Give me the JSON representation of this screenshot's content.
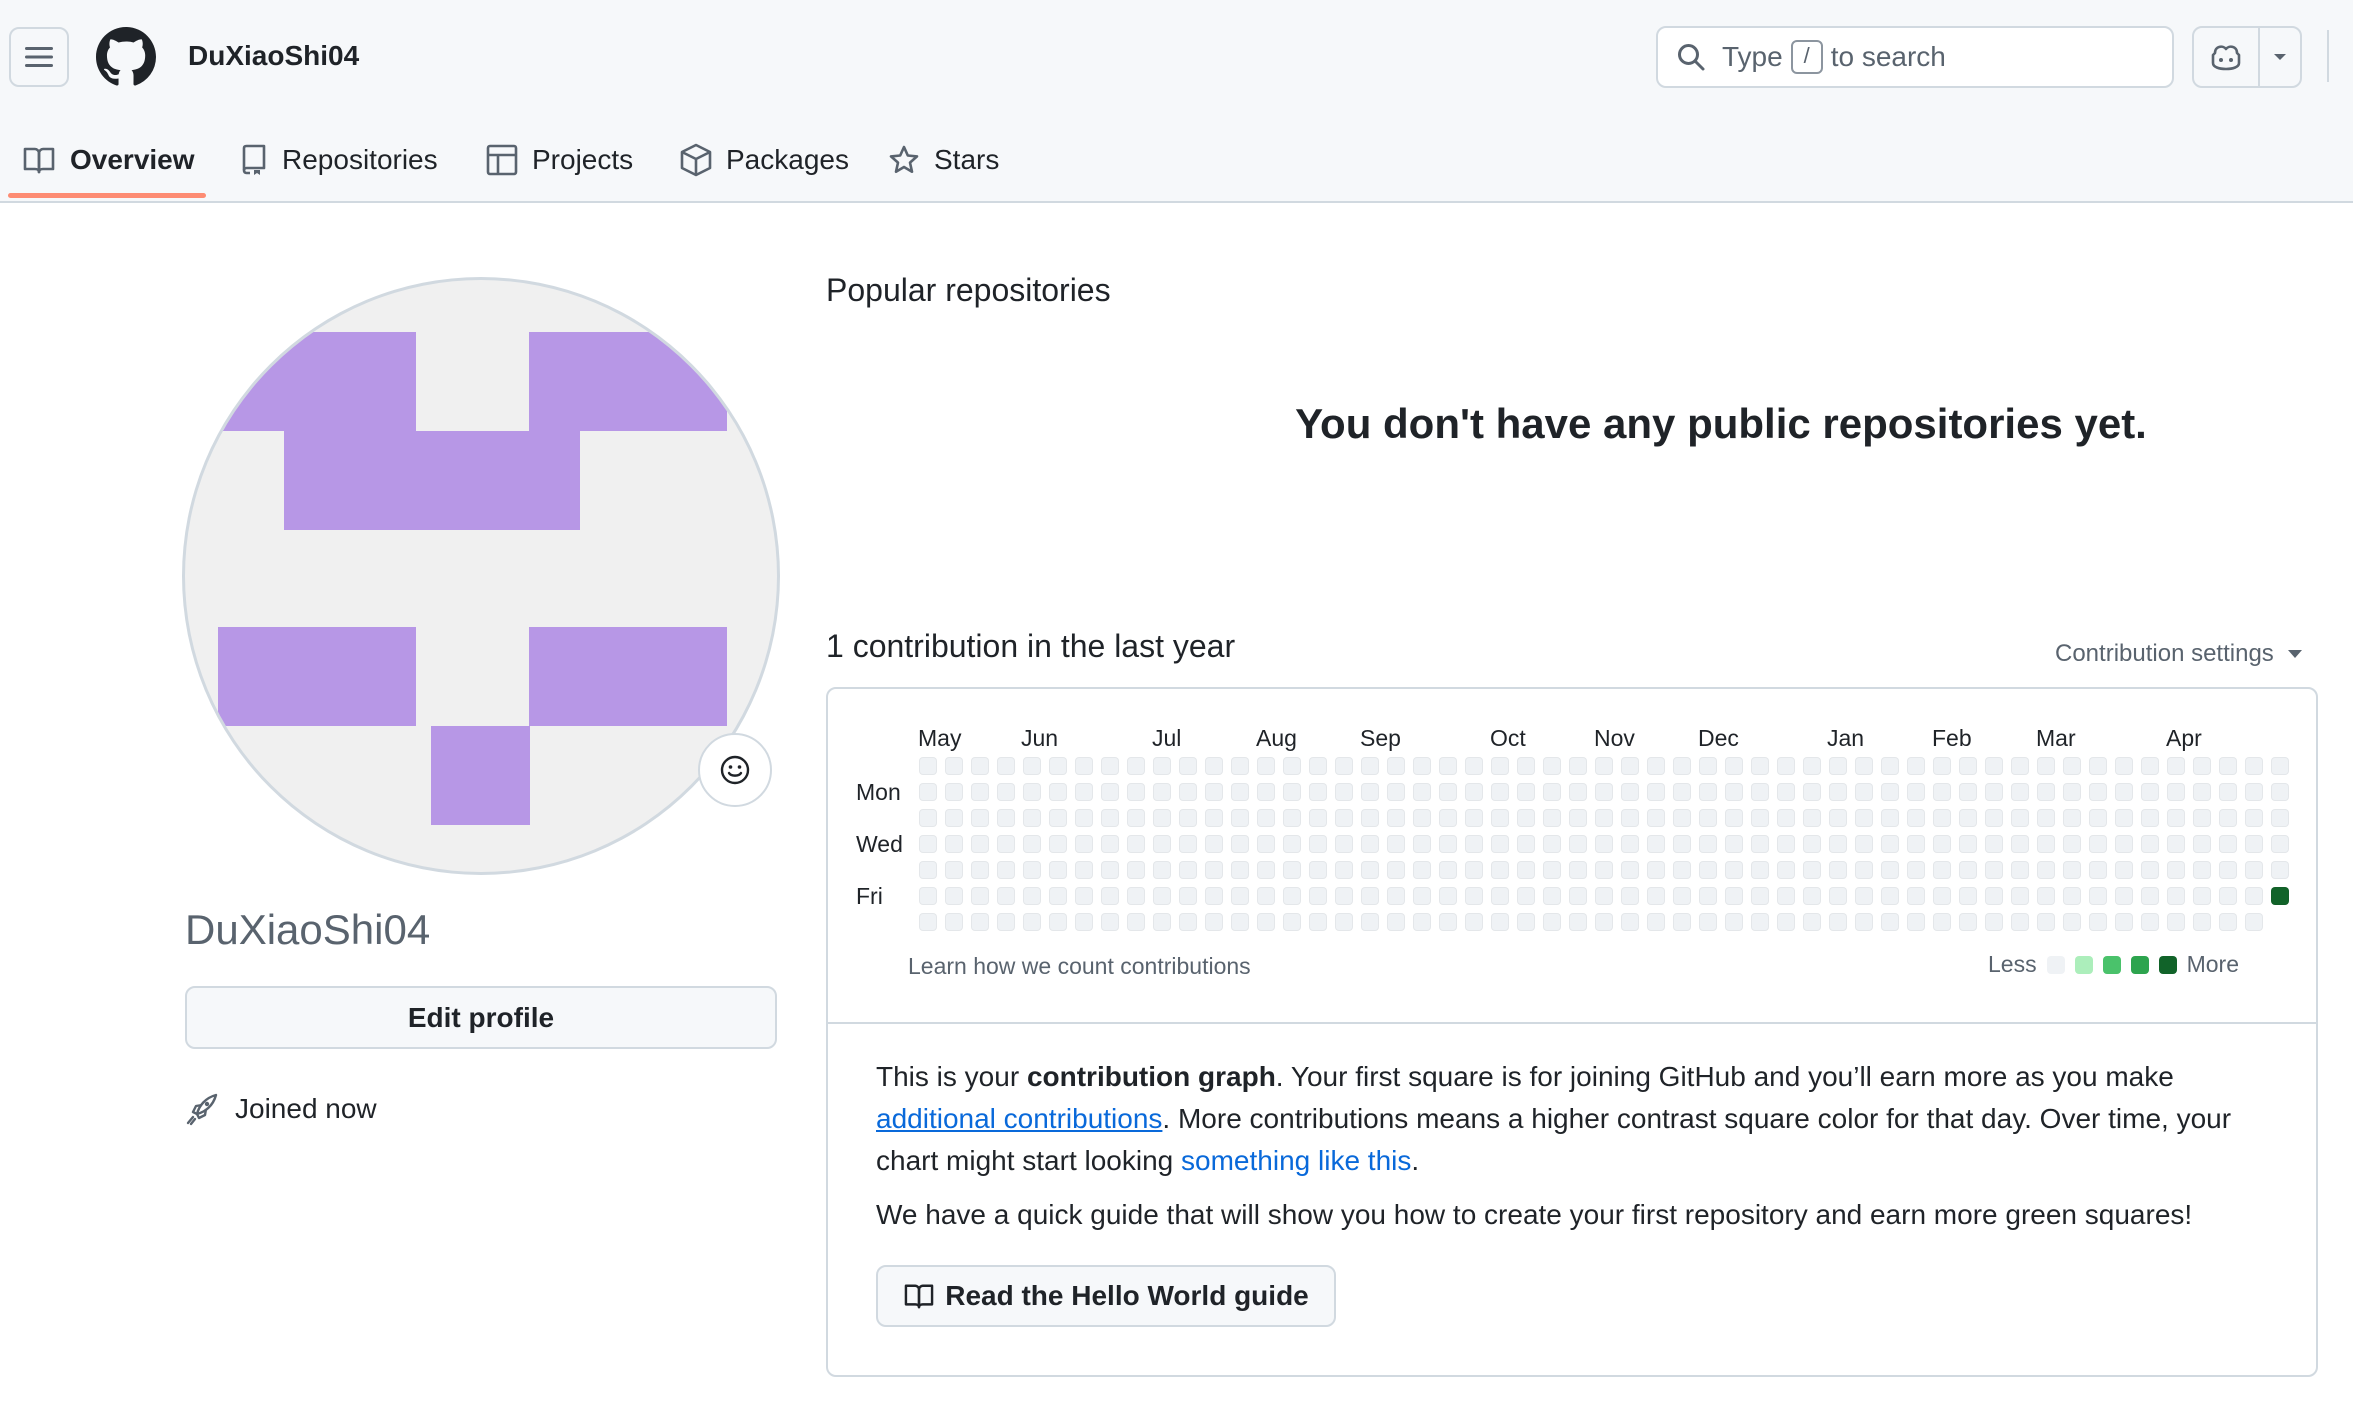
{
  "header": {
    "username": "DuXiaoShi04",
    "search_prefix": "Type",
    "search_key": "/",
    "search_suffix": "to search"
  },
  "tabs": [
    {
      "label": "Overview",
      "icon": "book-icon",
      "active": true
    },
    {
      "label": "Repositories",
      "icon": "repo-icon"
    },
    {
      "label": "Projects",
      "icon": "table-icon"
    },
    {
      "label": "Packages",
      "icon": "package-icon"
    },
    {
      "label": "Stars",
      "icon": "star-icon"
    }
  ],
  "profile": {
    "name": "DuXiaoShi04",
    "edit_label": "Edit profile",
    "joined": "Joined now",
    "avatar_color": "#b797e6"
  },
  "popular": {
    "title": "Popular repositories",
    "empty": "You don't have any public repositories yet."
  },
  "contributions": {
    "title": "1 contribution in the last year",
    "settings_label": "Contribution settings",
    "months": [
      "May",
      "Jun",
      "Jul",
      "Aug",
      "Sep",
      "Oct",
      "Nov",
      "Dec",
      "Jan",
      "Feb",
      "Mar",
      "Apr"
    ],
    "day_labels": [
      "Mon",
      "Wed",
      "Fri"
    ],
    "learn_link": "Learn how we count contributions",
    "legend_less": "Less",
    "legend_more": "More",
    "level_colors": [
      "#eff2f5",
      "#aceebb",
      "#4ac26b",
      "#2da44e",
      "#116329"
    ],
    "weeks": 53,
    "active_cell": {
      "week": 53,
      "day": 5,
      "level": 4
    }
  },
  "explain": {
    "p1_a": "This is your ",
    "p1_b": "contribution graph",
    "p1_c": ". Your first square is for joining GitHub and you’ll earn more as you make ",
    "p1_link1": "additional contributions",
    "p1_d": ". More contributions means a higher contrast square color for that day. Over time, your chart might start looking ",
    "p1_link2": "something like this",
    "p1_e": ".",
    "guide_text": "We have a quick guide that will show you how to create your first repository and earn more green squares!",
    "guide_button": "Read the Hello World guide"
  }
}
